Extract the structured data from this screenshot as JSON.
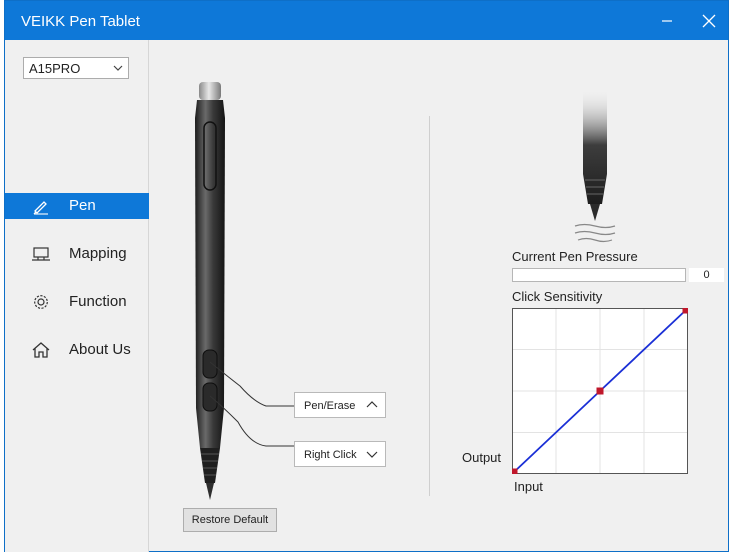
{
  "window": {
    "title": "VEIKK Pen Tablet",
    "accent_color": "#0e78d8",
    "minimize_icon": "minimize-icon",
    "close_icon": "close-icon"
  },
  "sidebar": {
    "device": "A15PRO",
    "items": [
      {
        "label": "Pen",
        "icon": "pen-icon",
        "active": true
      },
      {
        "label": "Mapping",
        "icon": "monitor-icon",
        "active": false
      },
      {
        "label": "Function",
        "icon": "gear-icon",
        "active": false
      },
      {
        "label": "About Us",
        "icon": "home-icon",
        "active": false
      }
    ]
  },
  "pen": {
    "upper_button": "Pen/Erase",
    "lower_button": "Right Click",
    "restore_label": "Restore Default"
  },
  "pressure": {
    "current_label": "Current Pen Pressure",
    "value": "0",
    "level": 0,
    "sensitivity_label": "Click Sensitivity",
    "output_label": "Output",
    "input_label": "Input",
    "curve_points": [
      [
        0,
        0
      ],
      [
        0.5,
        0.5
      ],
      [
        1,
        1
      ]
    ],
    "curve_color": "#1a2fd6",
    "handle_color": "#c0172b"
  }
}
